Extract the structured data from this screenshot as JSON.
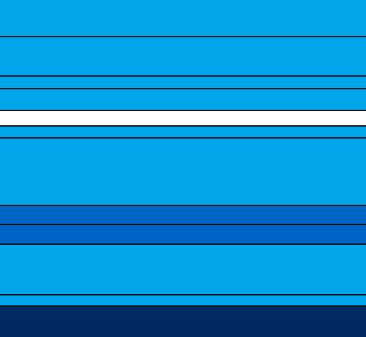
{
  "colors": {
    "background": "#00A6EA",
    "light_blue": "#00A6EA",
    "medium_blue": "#0064C6",
    "dark_navy": "#002B62",
    "white": "#FFFFFF",
    "divider": "#10141C"
  },
  "bands": [
    {
      "name": "band-1",
      "color": "light_blue"
    },
    {
      "name": "band-2",
      "color": "light_blue"
    },
    {
      "name": "band-3",
      "color": "light_blue"
    },
    {
      "name": "band-4",
      "color": "light_blue"
    },
    {
      "name": "band-5",
      "color": "white"
    },
    {
      "name": "band-6",
      "color": "light_blue"
    },
    {
      "name": "band-7",
      "color": "light_blue"
    },
    {
      "name": "band-8",
      "color": "medium_blue"
    },
    {
      "name": "band-9",
      "color": "medium_blue"
    },
    {
      "name": "band-10",
      "color": "light_blue"
    },
    {
      "name": "band-11",
      "color": "light_blue"
    },
    {
      "name": "band-12",
      "color": "dark_navy"
    }
  ]
}
